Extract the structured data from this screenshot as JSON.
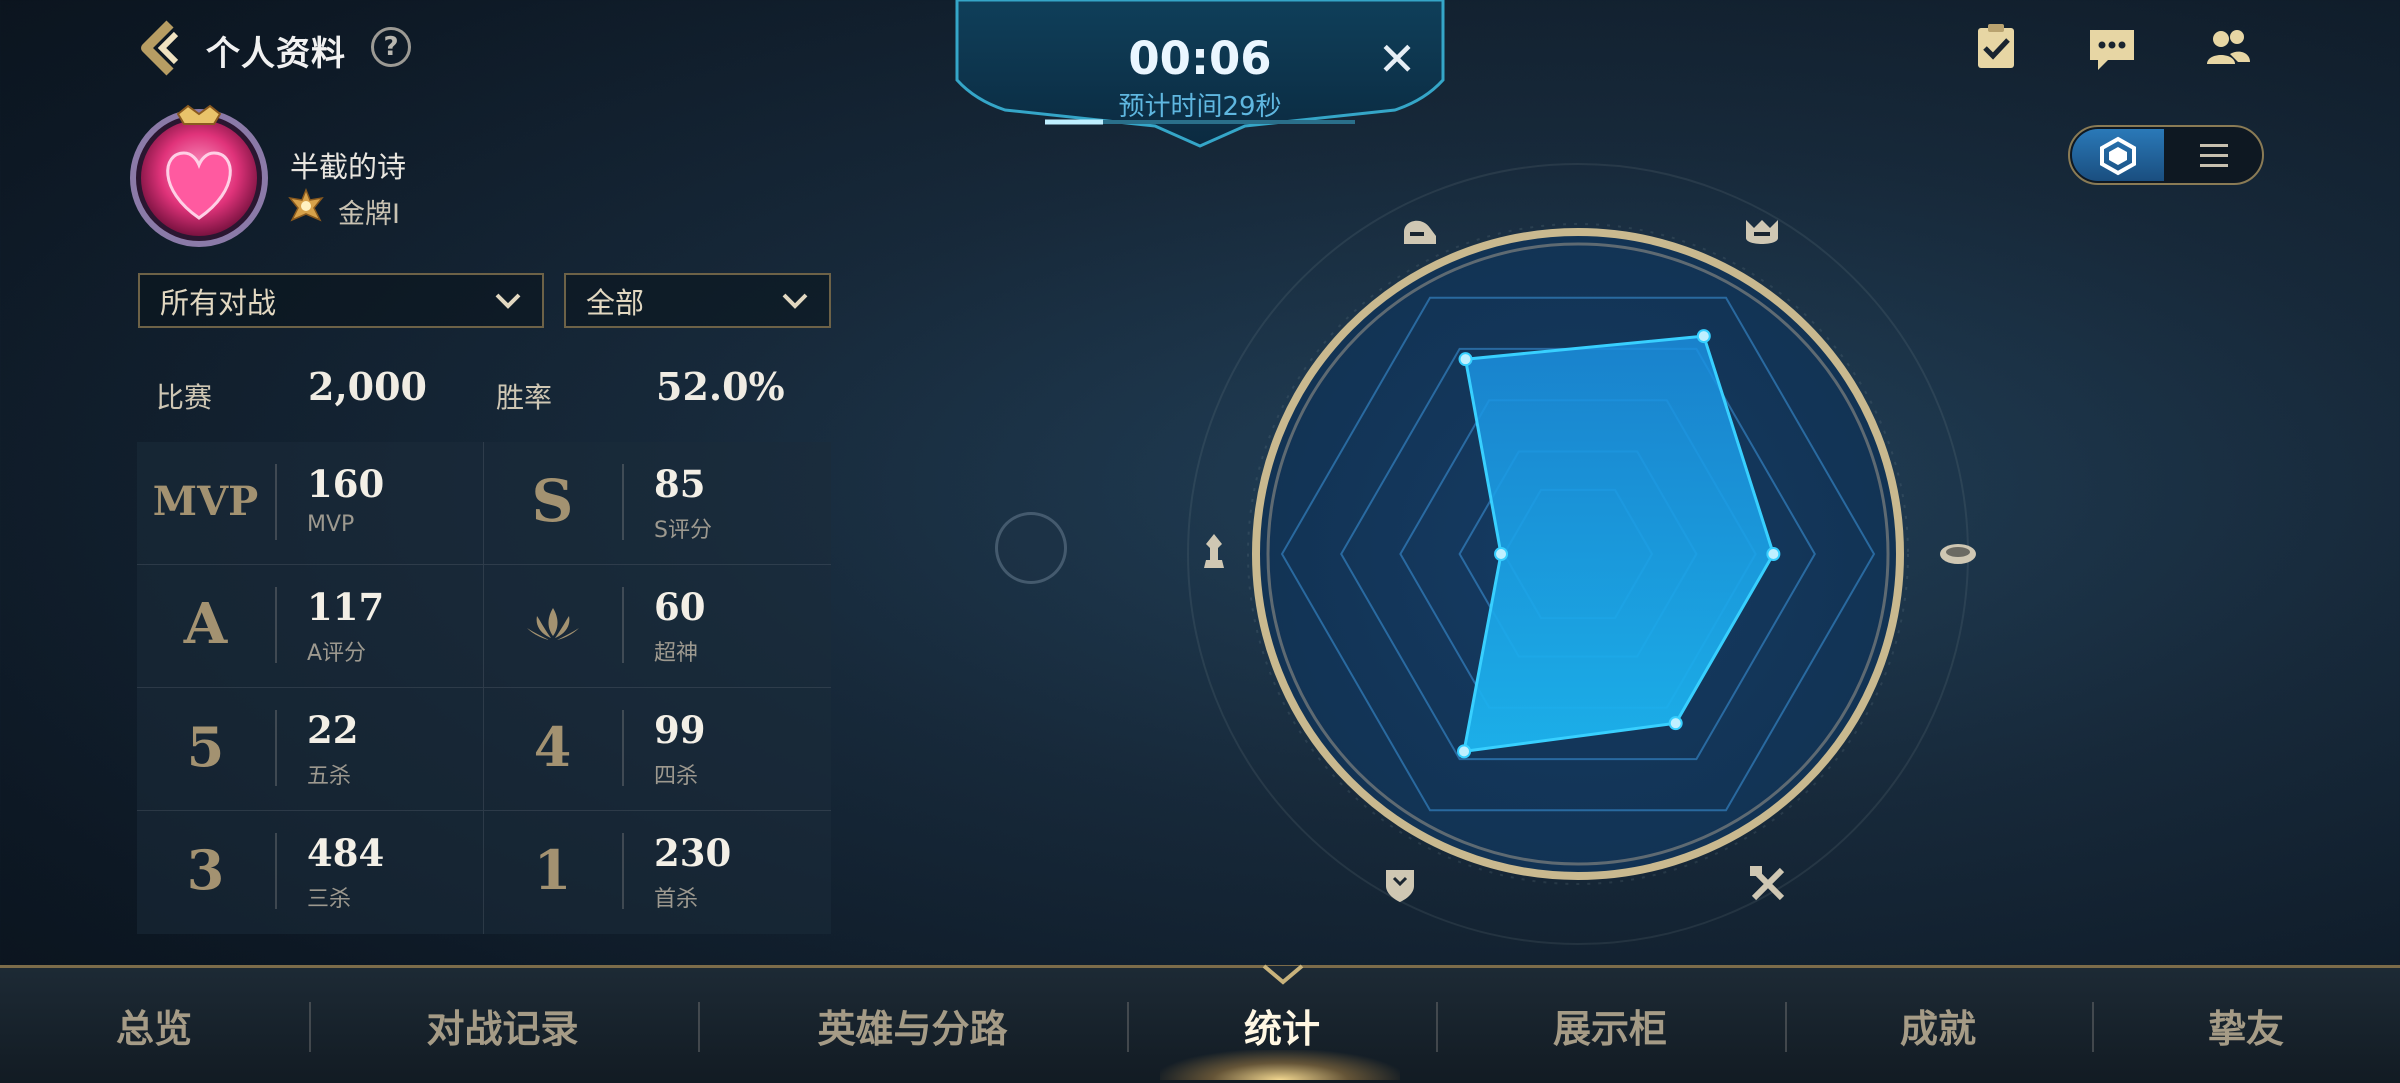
{
  "header": {
    "title": "个人资料",
    "help_glyph": "?"
  },
  "profile": {
    "name": "半截的诗",
    "rank": "金牌I"
  },
  "filters": {
    "mode": "所有对战",
    "category": "全部"
  },
  "summary": {
    "matches_label": "比赛",
    "matches_value": "2,000",
    "winrate_label": "胜率",
    "winrate_value": "52.0%"
  },
  "stats": [
    {
      "icon_text": "MVP",
      "icon": "mvp-icon",
      "value": "160",
      "label": "MVP"
    },
    {
      "icon_text": "S",
      "icon": "s-rating-icon",
      "value": "85",
      "label": "S评分"
    },
    {
      "icon_text": "A",
      "icon": "a-rating-icon",
      "value": "117",
      "label": "A评分"
    },
    {
      "icon_text": "",
      "icon": "legendary-crown-icon",
      "value": "60",
      "label": "超神"
    },
    {
      "icon_text": "5",
      "icon": "penta-kill-icon",
      "value": "22",
      "label": "五杀"
    },
    {
      "icon_text": "4",
      "icon": "quadra-kill-icon",
      "value": "99",
      "label": "四杀"
    },
    {
      "icon_text": "3",
      "icon": "triple-kill-icon",
      "value": "484",
      "label": "三杀"
    },
    {
      "icon_text": "1",
      "icon": "first-blood-icon",
      "value": "230",
      "label": "首杀"
    }
  ],
  "queue_timer": {
    "time": "00:06",
    "estimate": "预计时间29秒",
    "close_glyph": "✕"
  },
  "top_right_icons": [
    "task-checklist-icon",
    "chat-icon",
    "friends-icon"
  ],
  "view_toggle": {
    "active": "radar",
    "options": [
      "radar-view-icon",
      "list-view-icon"
    ]
  },
  "radar": {
    "axis_icons": [
      "fighter-helmet-icon",
      "assassin-helmet-icon",
      "economy-coin-icon",
      "push-tools-icon",
      "tank-shield-icon",
      "support-chess-icon"
    ],
    "values": [
      0.76,
      0.85,
      0.66,
      0.66,
      0.77,
      0.26
    ],
    "colors": {
      "fill": "#1aa8e8",
      "stroke": "#38d0ff",
      "ring": "#c9b98f"
    }
  },
  "nav": {
    "items": [
      "总览",
      "对战记录",
      "英雄与分路",
      "统计",
      "展示柜",
      "成就",
      "挚友"
    ],
    "active_index": 3
  }
}
